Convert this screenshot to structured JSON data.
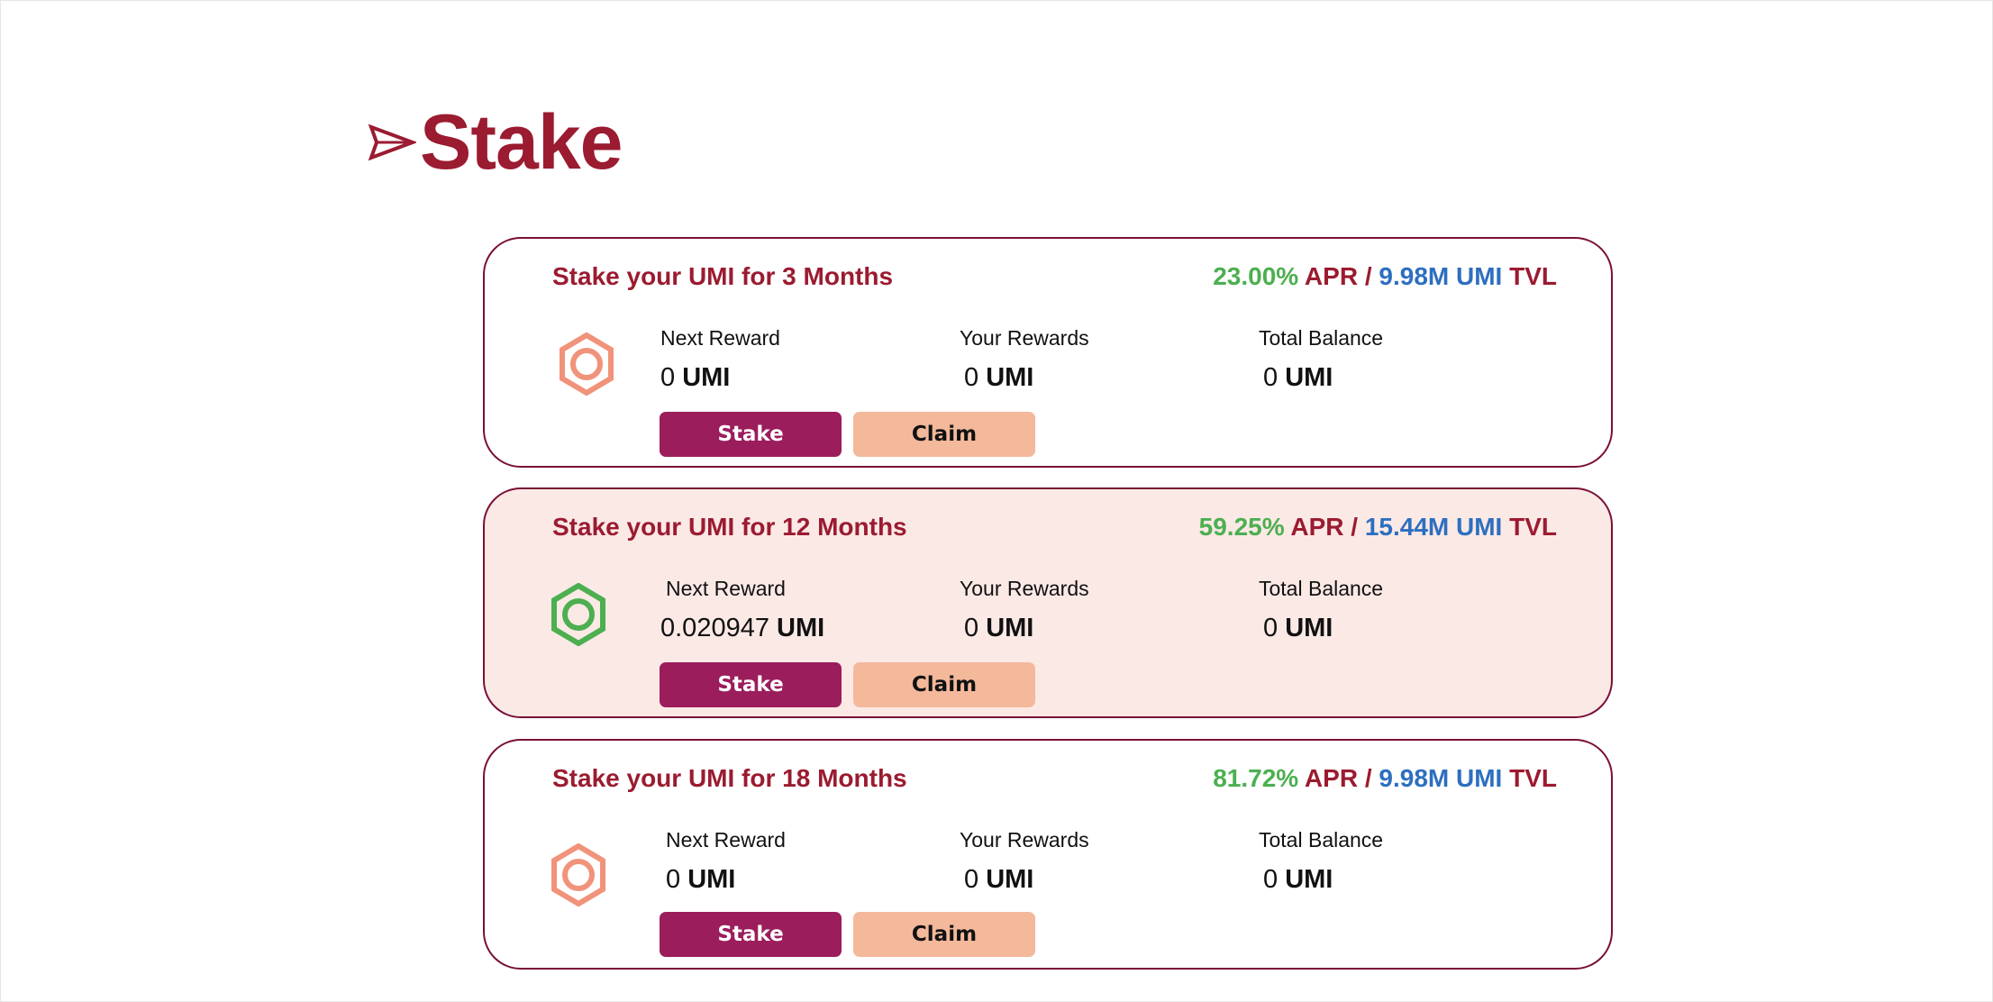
{
  "header": {
    "title": "Stake",
    "icon": "paper-plane-icon",
    "color": "#9b1b30"
  },
  "labels": {
    "next_reward": "Next Reward",
    "your_rewards": "Your Rewards",
    "total_balance": "Total Balance",
    "apr": "APR",
    "separator": "/",
    "tvl": "TVL",
    "unit": "UMI"
  },
  "colors": {
    "accent": "#9b1b30",
    "apr": "#4caf50",
    "tvl": "#2d6fbf",
    "stake_button": "#9b1d5c",
    "claim_button": "#f4b89b",
    "highlight_bg": "#fbe9e6",
    "icon_orange": "#f0937a",
    "icon_green": "#4caf50"
  },
  "pools": [
    {
      "title": "Stake your UMI for 3 Months",
      "apr": "23.00%",
      "tvl": "9.98M UMI",
      "next_reward": "0",
      "your_rewards": "0",
      "total_balance": "0",
      "stake_label": "Stake",
      "claim_label": "Claim",
      "icon": "hexagon-ring-icon",
      "icon_color": "#f0937a"
    },
    {
      "title": "Stake your UMI for 12 Months",
      "apr": "59.25%",
      "tvl": "15.44M UMI",
      "next_reward": "0.020947",
      "your_rewards": "0",
      "total_balance": "0",
      "stake_label": "Stake",
      "claim_label": "Claim",
      "icon": "hexagon-ring-icon",
      "icon_color": "#4caf50"
    },
    {
      "title": "Stake your UMI for 18 Months",
      "apr": "81.72%",
      "tvl": "9.98M UMI",
      "next_reward": "0",
      "your_rewards": "0",
      "total_balance": "0",
      "stake_label": "Stake",
      "claim_label": "Claim",
      "icon": "hexagon-ring-icon",
      "icon_color": "#f0937a"
    }
  ]
}
